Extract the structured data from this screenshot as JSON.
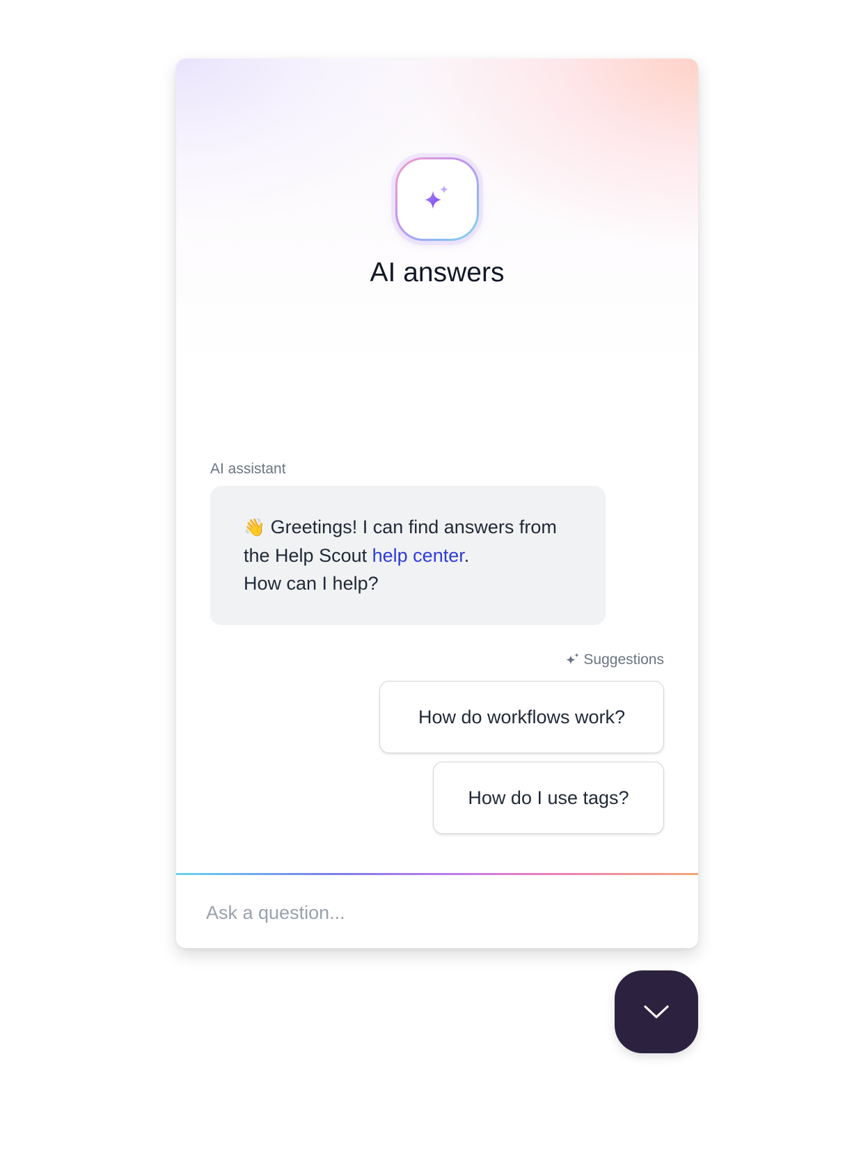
{
  "header": {
    "title": "AI answers",
    "icon": "sparkles-icon"
  },
  "conversation": {
    "sender_label": "AI assistant",
    "greeting": {
      "emoji": "👋",
      "text_before_link": "Greetings! I can find answers from the Help Scout ",
      "link_text": "help center",
      "text_after_link": ".",
      "question": "How can I help?"
    }
  },
  "suggestions": {
    "label": "Suggestions",
    "items": [
      {
        "label": "How do workflows work?"
      },
      {
        "label": "How do I use tags?"
      }
    ]
  },
  "composer": {
    "placeholder": "Ask a question...",
    "value": ""
  },
  "launcher": {
    "icon": "chevron-down-icon"
  },
  "colors": {
    "accent_dark": "#2c2240",
    "link": "#2e3cd6",
    "bubble_bg": "#f1f2f4",
    "sparkle_purple": "#8b5cf6"
  }
}
